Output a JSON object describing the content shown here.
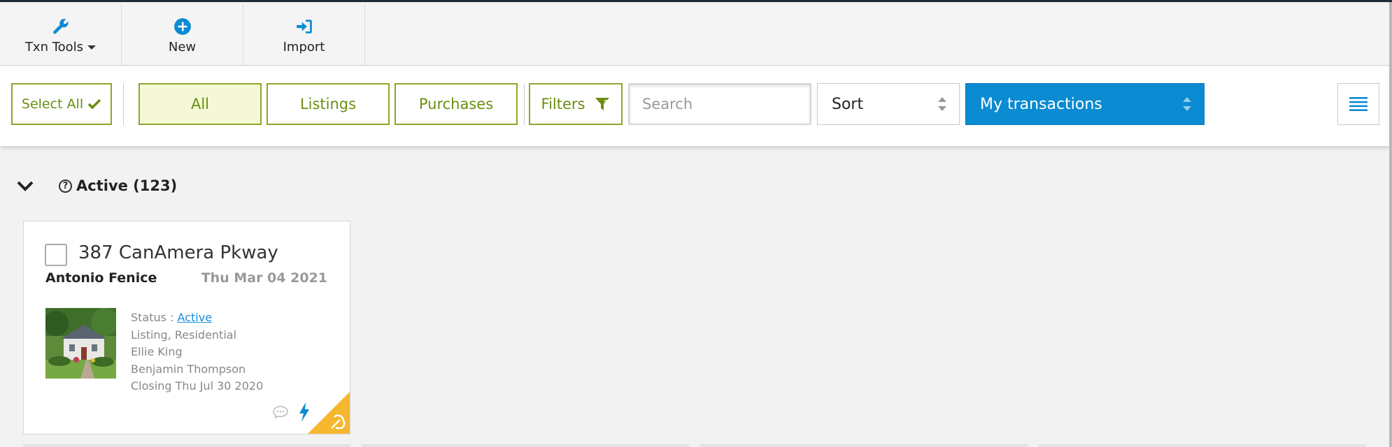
{
  "toolbar": {
    "txn_tools": "Txn Tools",
    "new": "New",
    "import": "Import"
  },
  "filters": {
    "select_all": "Select All",
    "tabs": [
      "All",
      "Listings",
      "Purchases"
    ],
    "active_tab": "All",
    "filters_label": "Filters",
    "search_placeholder": "Search",
    "sort_label": "Sort",
    "owner_label": "My transactions"
  },
  "section": {
    "title": "Active (123)",
    "help_glyph": "?",
    "expanded": true
  },
  "card": {
    "address": "387 CanAmera Pkway",
    "agent": "Antonio Fenice",
    "date": "Thu Mar 04 2021",
    "status_prefix": "Status : ",
    "status": "Active",
    "type": "Listing, Residential",
    "person1": "Ellie King",
    "person2": "Benjamin Thompson",
    "closing": "Closing Thu Jul 30 2020"
  },
  "colors": {
    "accent_green": "#8fa62a",
    "accent_blue": "#0a8bd2",
    "link_blue": "#1a8dd8",
    "corner_yellow": "#f5b72d"
  },
  "icons": {
    "txn_tools": "wrench-icon",
    "new": "plus-circle-icon",
    "import": "import-icon",
    "select_all": "check-icon",
    "filters": "funnel-icon",
    "menu": "list-menu-icon",
    "section_toggle": "chevron-down-icon",
    "help": "help-circle-icon",
    "comment": "comment-icon",
    "lightning": "lightning-icon",
    "corner": "hand-corner-icon"
  }
}
